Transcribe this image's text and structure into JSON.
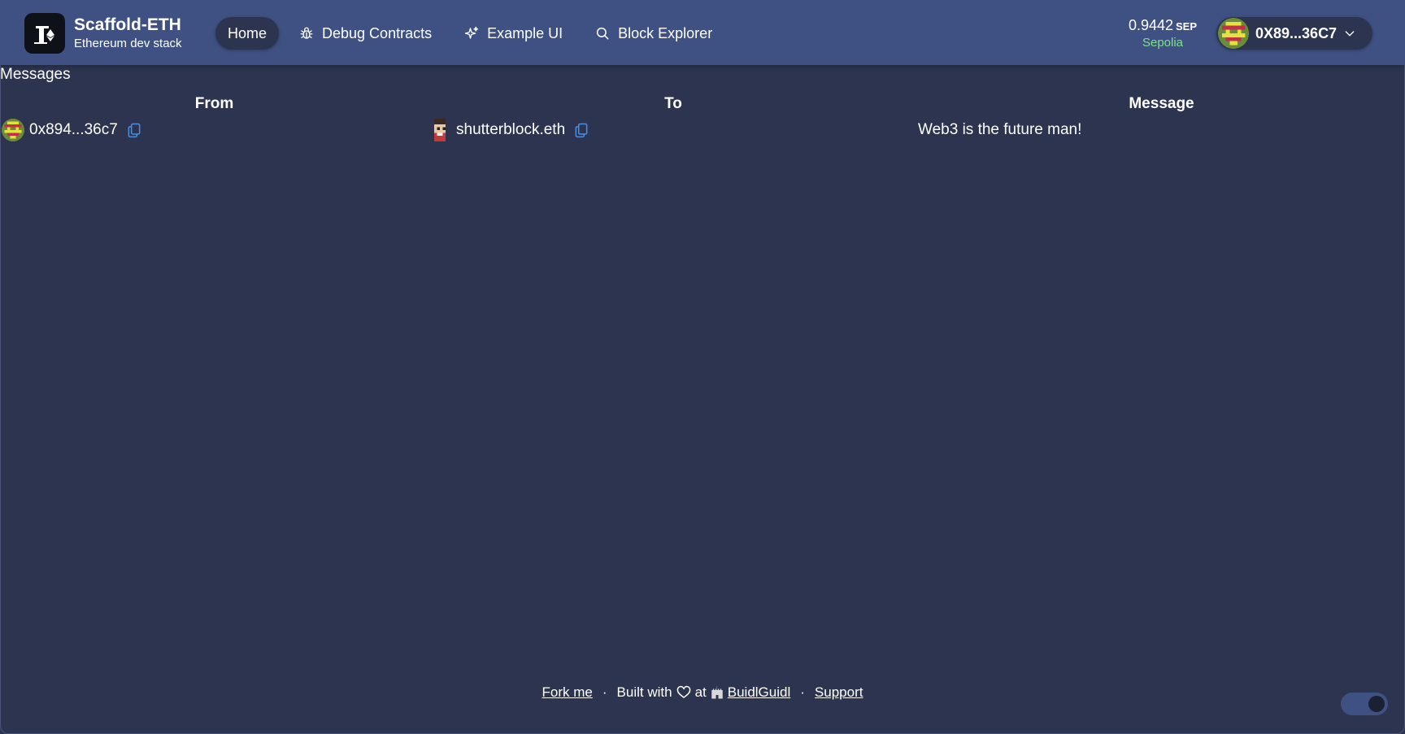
{
  "brand": {
    "title": "Scaffold-ETH",
    "subtitle": "Ethereum dev stack"
  },
  "nav": {
    "items": [
      {
        "label": "Home",
        "icon": "none",
        "active": true
      },
      {
        "label": "Debug Contracts",
        "icon": "bug-icon",
        "active": false
      },
      {
        "label": "Example UI",
        "icon": "sparkles-icon",
        "active": false
      },
      {
        "label": "Block Explorer",
        "icon": "search-icon",
        "active": false
      }
    ]
  },
  "wallet": {
    "balance": "0.9442",
    "unit": "SEP",
    "network": "Sepolia",
    "account": "0X89...36C7"
  },
  "page": {
    "title": "Messages"
  },
  "table": {
    "headers": [
      "From",
      "To",
      "Message"
    ],
    "rows": [
      {
        "from": "0x894...36c7",
        "to": "shutterblock.eth",
        "message": "Web3 is the future man!"
      }
    ]
  },
  "footer": {
    "fork_me": "Fork me",
    "built_with": "Built with",
    "at": "at",
    "buidlguidl": "BuidlGuidl",
    "support": "Support"
  },
  "colors": {
    "background": "#2c3450",
    "header": "#3f5183",
    "copy_icon": "#4a8fe0",
    "network": "#7ee08a"
  }
}
